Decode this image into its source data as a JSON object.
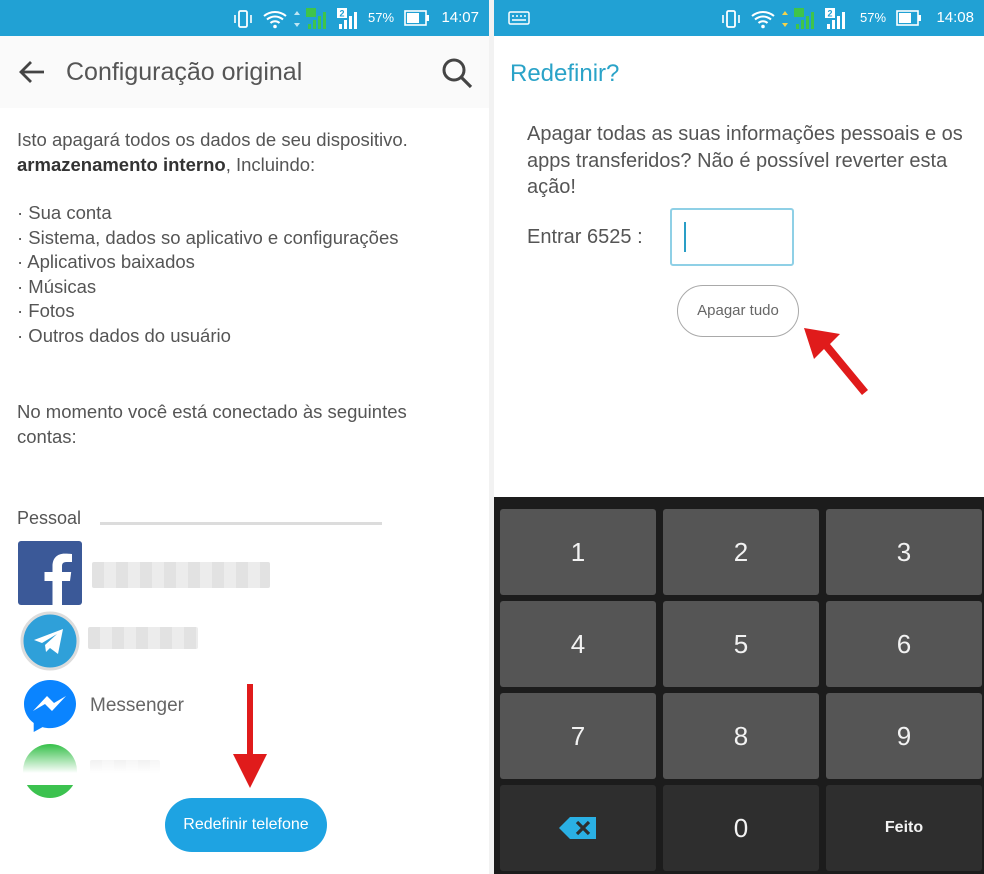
{
  "left": {
    "status": {
      "battery": "57%",
      "time": "14:07"
    },
    "appbar": {
      "title": "Configuração original"
    },
    "intro": {
      "line1": "Isto apagará todos os dados de seu dispositivo.",
      "bold": "armazenamento interno",
      "rest": ", Incluindo:"
    },
    "bullets": [
      "· Sua conta",
      "· Sistema, dados so aplicativo e configurações",
      "· Aplicativos baixados",
      "· Músicas",
      "· Fotos",
      "· Outros dados do usuário"
    ],
    "connected": {
      "line1": "No momento você está conectado às seguintes",
      "line2": "contas:"
    },
    "section": "Pessoal",
    "accounts": [
      {
        "icon": "facebook-icon",
        "name": ""
      },
      {
        "icon": "telegram-icon",
        "name": ""
      },
      {
        "icon": "messenger-icon",
        "name": "Messenger"
      },
      {
        "icon": "whatsapp-icon",
        "name": ""
      }
    ],
    "button": "Redefinir telefone"
  },
  "right": {
    "status": {
      "battery": "57%",
      "time": "14:08"
    },
    "title": "Redefinir?",
    "message": "Apagar todas as suas informações pessoais e os apps transferidos? Não é possível reverter esta ação!",
    "enter_label": "Entrar 6525 :",
    "input_value": "",
    "erase_button": "Apagar tudo",
    "keypad": [
      "1",
      "2",
      "3",
      "4",
      "5",
      "6",
      "7",
      "8",
      "9",
      "",
      "0",
      "Feito"
    ]
  },
  "colors": {
    "status_bar": "#21a1d4",
    "accent": "#1ea3e2",
    "title": "#2aa3c8",
    "arrow": "#e01b1b"
  }
}
